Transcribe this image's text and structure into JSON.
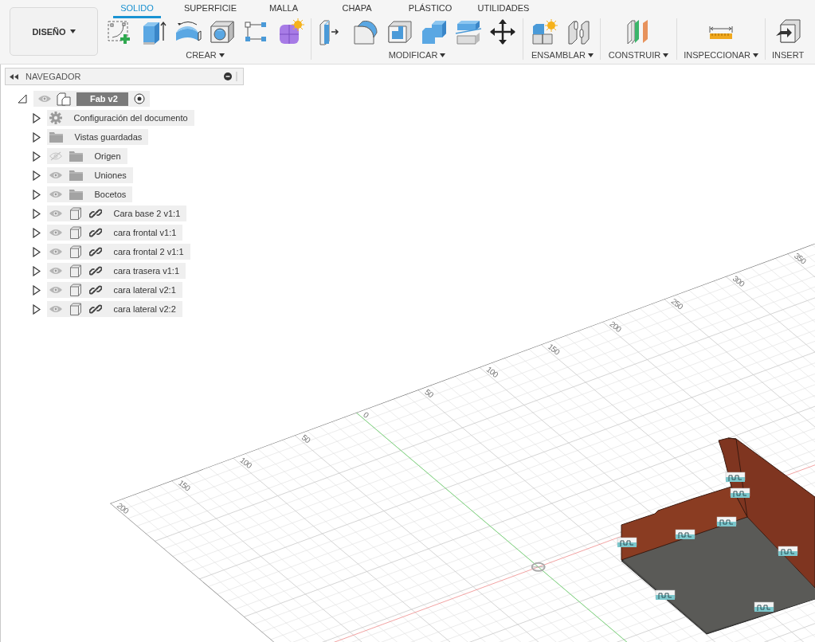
{
  "toolbar": {
    "workspace_button": "DISEÑO",
    "tabs": [
      {
        "label": "SOLIDO",
        "selected": true
      },
      {
        "label": "SUPERFICIE",
        "selected": false
      },
      {
        "label": "MALLA",
        "selected": false
      },
      {
        "label": "CHAPA",
        "selected": false
      },
      {
        "label": "PLÁSTICO",
        "selected": false
      },
      {
        "label": "UTILIDADES",
        "selected": false
      }
    ],
    "groups": [
      {
        "label": "CREAR",
        "dropdown": true
      },
      {
        "label": "MODIFICAR",
        "dropdown": true
      },
      {
        "label": "ENSAMBLAR",
        "dropdown": true
      },
      {
        "label": "CONSTRUIR",
        "dropdown": true
      },
      {
        "label": "INSPECCIONAR",
        "dropdown": true
      },
      {
        "label": "INSERT",
        "dropdown": false
      }
    ]
  },
  "navigator": {
    "title": "NAVEGADOR",
    "root": {
      "label": "Fab v2",
      "expanded": true,
      "visible": true,
      "children": [
        {
          "kind": "settings",
          "label": "Configuración del documento",
          "expanded": false
        },
        {
          "kind": "folder",
          "label": "Vistas guardadas",
          "expanded": false
        },
        {
          "kind": "folder",
          "label": "Origen",
          "visible": false,
          "expanded": false
        },
        {
          "kind": "folder",
          "label": "Uniones",
          "visible": true,
          "expanded": false
        },
        {
          "kind": "folder",
          "label": "Bocetos",
          "visible": true,
          "expanded": false
        },
        {
          "kind": "component",
          "label": "Cara base 2 v1:1",
          "visible": true,
          "expanded": false
        },
        {
          "kind": "component",
          "label": "cara frontal v1:1",
          "visible": true,
          "expanded": false
        },
        {
          "kind": "component",
          "label": "cara frontal 2 v1:1",
          "visible": true,
          "expanded": false
        },
        {
          "kind": "component",
          "label": "cara trasera v1:1",
          "visible": true,
          "expanded": false
        },
        {
          "kind": "component",
          "label": "cara lateral v2:1",
          "visible": true,
          "expanded": false
        },
        {
          "kind": "component",
          "label": "cara lateral v2:2",
          "visible": true,
          "expanded": false
        }
      ]
    }
  },
  "viewport": {
    "axis_labels": [
      "200",
      "150",
      "100",
      "50",
      "0",
      "50",
      "100",
      "150",
      "200",
      "250",
      "300",
      "350"
    ]
  }
}
